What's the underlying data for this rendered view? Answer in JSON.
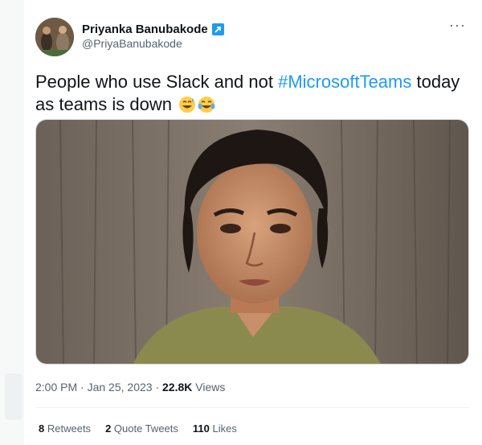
{
  "author": {
    "display_name": "Priyanka Banubakode",
    "handle": "@PriyaBanubakode",
    "badge_icon": "verified-badge-icon"
  },
  "tweet": {
    "text_before": "People who use Slack and not ",
    "hashtag": "#MicrosoftTeams",
    "text_after": " today as teams is down",
    "emojis": [
      "grinning-sweat-emoji",
      "tears-of-joy-emoji"
    ]
  },
  "menu": {
    "icon": "more-icon",
    "label": "···"
  },
  "meta": {
    "time": "2:00 PM",
    "separator": "·",
    "date": "Jan 25, 2023",
    "views_count": "22.8K",
    "views_label": "Views"
  },
  "stats": {
    "retweets_count": "8",
    "retweets_label": "Retweets",
    "quotes_count": "2",
    "quotes_label": "Quote Tweets",
    "likes_count": "110",
    "likes_label": "Likes"
  },
  "colors": {
    "accent": "#1d9bf0",
    "text_primary": "#0f1419",
    "text_secondary": "#536471"
  }
}
